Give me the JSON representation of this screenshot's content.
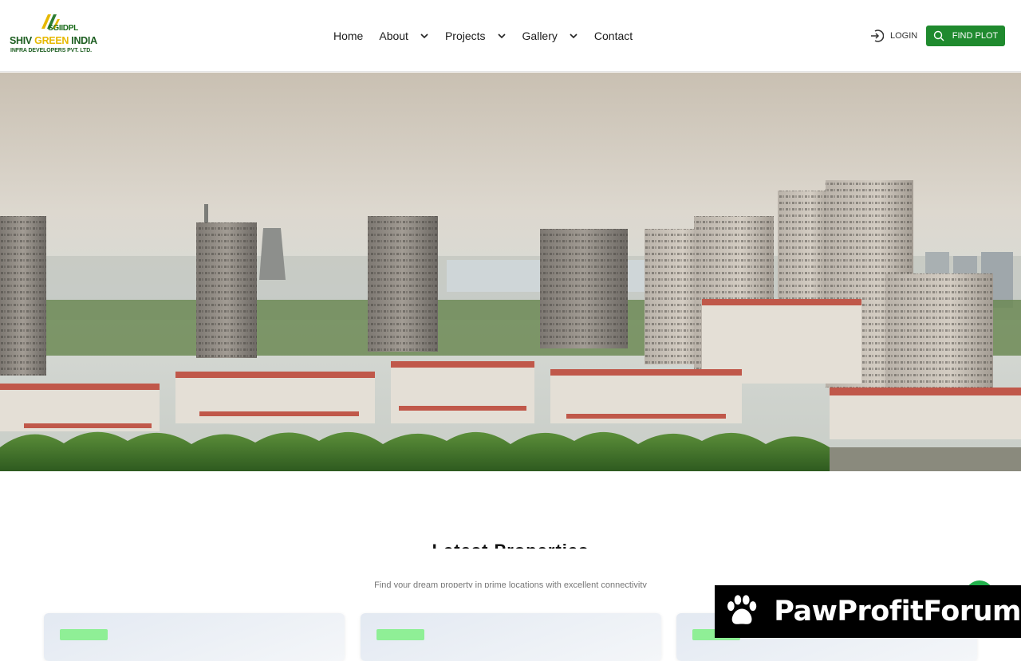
{
  "logo": {
    "abbr": "SGIIDPL",
    "name_part1": "SHIV ",
    "name_part2": "GREEN",
    "name_part3": " INDIA",
    "tagline": "INFRA DEVELOPERS PVT. LTD."
  },
  "nav": {
    "items": [
      {
        "label": "Home",
        "has_dropdown": false
      },
      {
        "label": "About",
        "has_dropdown": true
      },
      {
        "label": "Projects",
        "has_dropdown": true
      },
      {
        "label": "Gallery",
        "has_dropdown": true
      },
      {
        "label": "Contact",
        "has_dropdown": false
      }
    ]
  },
  "actions": {
    "login_label": "LOGIN",
    "login_icon": "login-icon",
    "find_plot_label": "FIND PLOT",
    "find_plot_icon": "search-icon"
  },
  "colors": {
    "accent_green": "#1f8a2e",
    "badge_green": "#8fef96",
    "whatsapp_green": "#22b14c"
  },
  "section": {
    "title": "Latest Properties",
    "subtitle": "Find your dream property in prime locations with excellent connectivity"
  },
  "watermark": {
    "text": "PawProfitForum",
    "icon": "paw-icon"
  }
}
